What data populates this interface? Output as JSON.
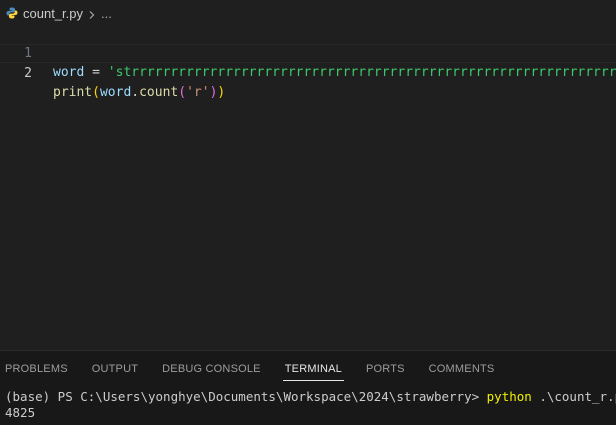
{
  "breadcrumb": {
    "file_name": "count_r.py",
    "more": "..."
  },
  "editor": {
    "lines": [
      {
        "number": "1",
        "tokens": {
          "var": "word",
          "eq": " = ",
          "quote": "'",
          "str_start": "st",
          "str_rest": "rrrrrrrrrrrrrrrrrrrrrrrrrrrrrrrrrrrrrrrrrrrrrrrrrrrrrrrrrrrrrrrrrrr"
        }
      },
      {
        "number": "2",
        "tokens": {
          "fn": "print",
          "p1": "(",
          "arg": "word",
          "dot": ".",
          "method": "count",
          "p2": "(",
          "str": "'r'",
          "p3": ")",
          "p4": ")"
        }
      }
    ]
  },
  "panel": {
    "tabs": [
      "PROBLEMS",
      "OUTPUT",
      "DEBUG CONSOLE",
      "TERMINAL",
      "PORTS",
      "COMMENTS"
    ],
    "active_tab": "TERMINAL"
  },
  "terminal": {
    "prompt": "(base) PS C:\\Users\\yonghye\\Documents\\Workspace\\2024\\strawberry> ",
    "command": "python",
    "args": " .\\count_r.py",
    "output": "4825"
  },
  "colors": {
    "background": "#1f1f1f",
    "string_green": "#3ec96c",
    "command_yellow": "#f1f100"
  }
}
